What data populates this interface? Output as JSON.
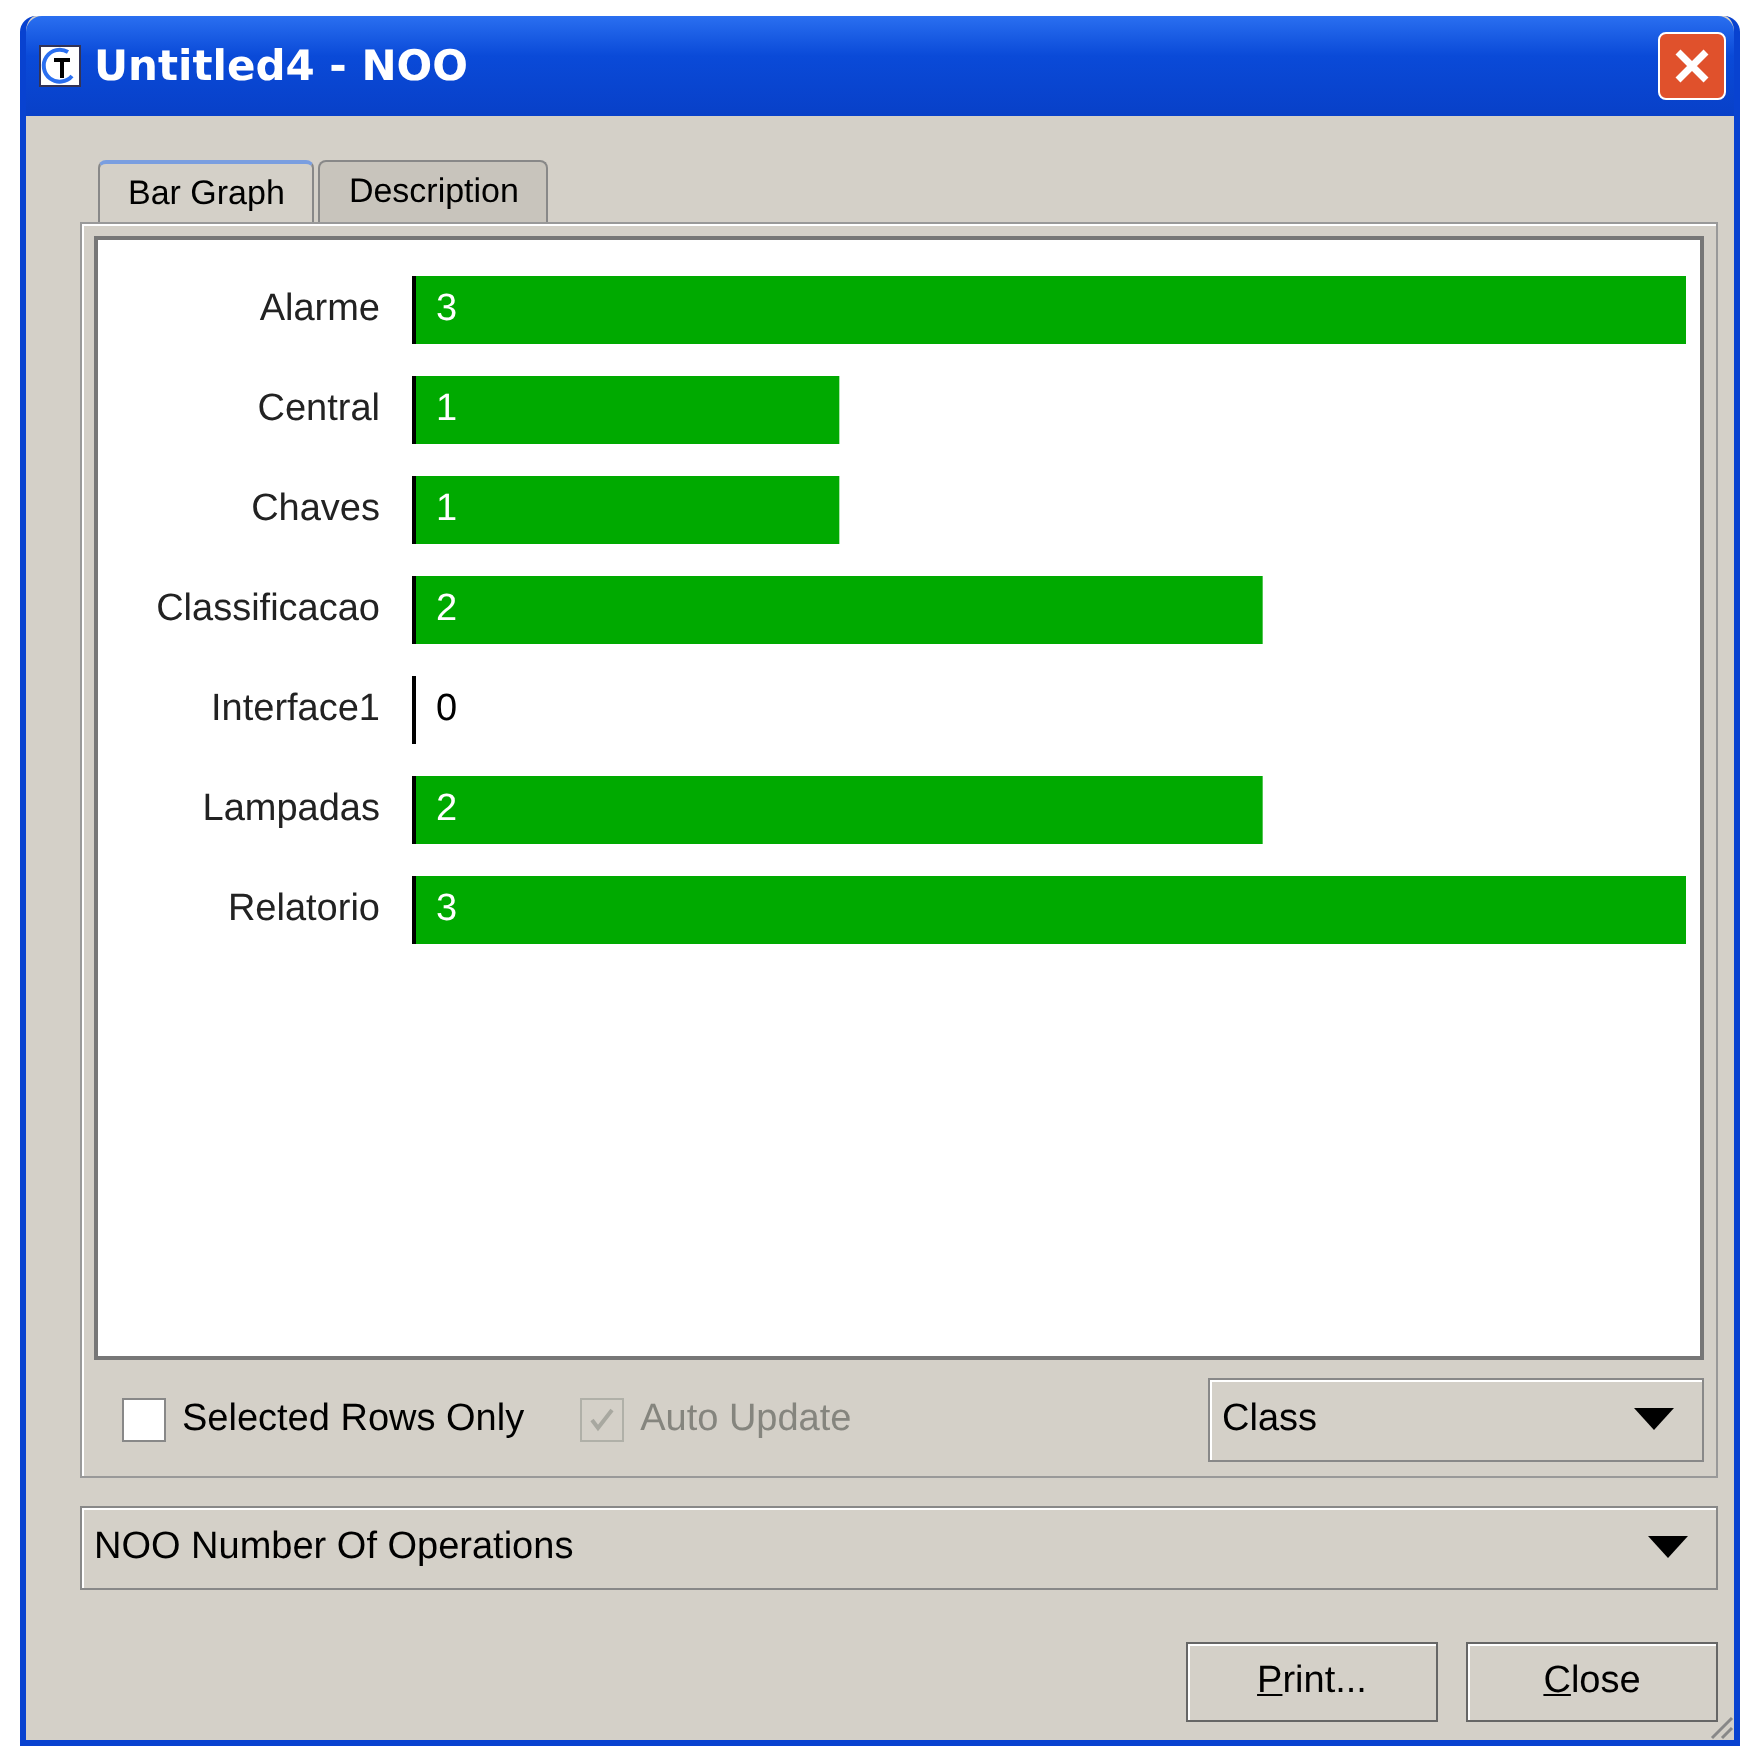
{
  "window": {
    "title": "Untitled4 - NOO"
  },
  "tabs": [
    {
      "label": "Bar Graph",
      "selected": true
    },
    {
      "label": "Description",
      "selected": false
    }
  ],
  "chart_data": {
    "type": "bar",
    "orientation": "horizontal",
    "data_labels": true,
    "categories": [
      "Alarme",
      "Central",
      "Chaves",
      "Classificacao",
      "Interface1",
      "Lampadas",
      "Relatorio"
    ],
    "series": [
      {
        "color": "#00aa00",
        "values": [
          3,
          1,
          1,
          2,
          0,
          2,
          3
        ]
      }
    ]
  },
  "options": [
    {
      "label": "Selected Rows Only",
      "checked": false,
      "disabled": false
    },
    {
      "label": "Auto Update",
      "checked": true,
      "disabled": true
    }
  ],
  "group_by": {
    "value": "Class"
  },
  "metric": {
    "value": "NOO Number Of Operations"
  },
  "buttons": [
    {
      "label": "Print..."
    },
    {
      "label": "Close"
    }
  ]
}
